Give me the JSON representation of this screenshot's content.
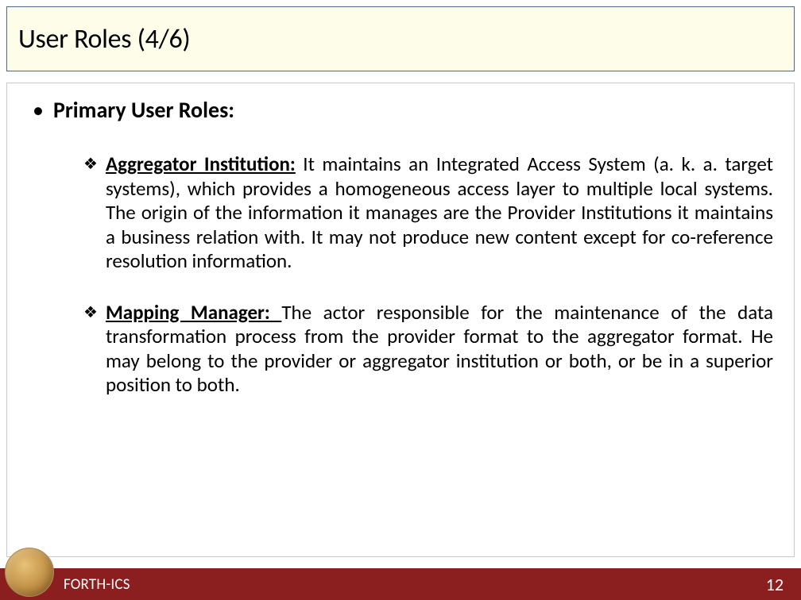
{
  "slide": {
    "title": "User Roles (4/6)",
    "heading": "Primary User Roles:",
    "items": [
      {
        "term": "Aggregator Institution:",
        "desc": " It maintains an Integrated Access System (a. k. a. target systems), which provides a homogeneous access layer to multiple local systems. The origin of the information it manages are the Provider Institutions it maintains a business relation with. It may not produce new content except for co-reference resolution information."
      },
      {
        "term": "Mapping Manager: ",
        "desc": "The actor responsible for the maintenance of the data transformation process from the provider format to the aggregator format. He may belong to the provider or aggregator institution or both, or be in a superior position to both."
      }
    ]
  },
  "footer": {
    "org": "FORTH-ICS",
    "page": "12"
  },
  "bullets": {
    "dot": "•",
    "diamond": "❖"
  }
}
